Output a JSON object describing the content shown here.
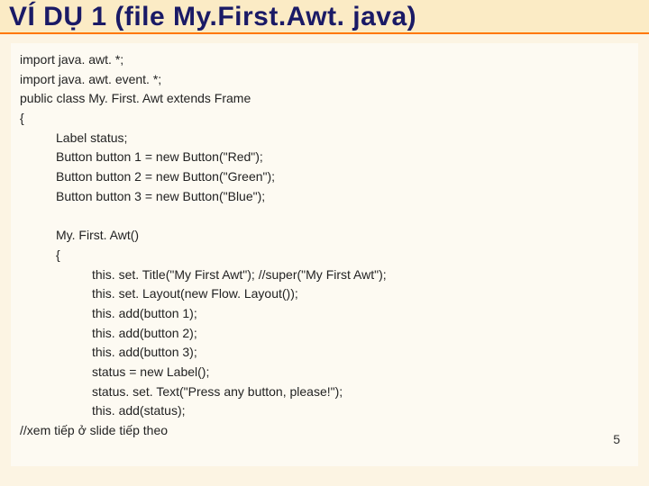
{
  "title": "VÍ DỤ 1 (file My.First.Awt. java)",
  "page_number": "5",
  "code": {
    "l1": "import java. awt. *;",
    "l2": "import java. awt. event. *;",
    "l3": "public class My. First. Awt extends Frame",
    "l4": "{",
    "l5": "Label status;",
    "l6": "Button button 1 = new Button(\"Red\");",
    "l7": "Button button 2 = new Button(\"Green\");",
    "l8": "Button button 3 = new Button(\"Blue\");",
    "l9": "My. First. Awt()",
    "l10": "{",
    "l11": "this. set. Title(\"My First Awt\"); //super(\"My First Awt\");",
    "l12": "this. set. Layout(new Flow. Layout());",
    "l13": "this. add(button 1);",
    "l14": "this. add(button 2);",
    "l15": "this. add(button 3);",
    "l16": "status = new Label();",
    "l17": "status. set. Text(\"Press any button, please!\");",
    "l18": "this. add(status);",
    "l19": "//xem tiếp ở slide tiếp theo"
  }
}
